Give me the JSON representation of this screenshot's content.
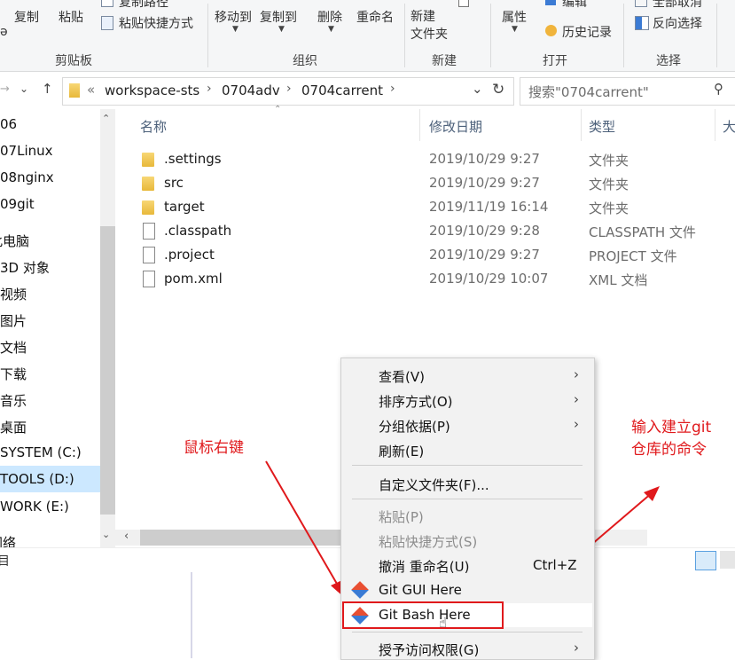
{
  "ribbon": {
    "clipboard": {
      "copy_label": "复制",
      "paste_label": "粘贴",
      "copy_path_label": "复制路径",
      "paste_shortcut_label": "粘贴快捷方式",
      "group_label": "剪贴板"
    },
    "organize": {
      "move_to_label": "移动到",
      "copy_to_label": "复制到",
      "delete_label": "删除",
      "rename_label": "重命名",
      "group_label": "组织"
    },
    "new": {
      "new_folder_label": "新建\n文件夹",
      "group_label": "新建"
    },
    "open": {
      "properties_label": "属性",
      "edit_label": "编辑",
      "history_label": "历史记录",
      "group_label": "打开"
    },
    "select": {
      "select_none_label": "全部取消",
      "invert_label": "反向选择",
      "group_label": "选择"
    }
  },
  "address": {
    "sep": "«",
    "crumbs": [
      "workspace-sts",
      "0704adv",
      "0704carrent"
    ],
    "search_placeholder": "搜索\"0704carrent\""
  },
  "nav": {
    "items": [
      "06",
      "07Linux",
      "08nginx",
      "09git",
      "此电脑",
      "3D 对象",
      "视频",
      "图片",
      "文档",
      "下载",
      "音乐",
      "桌面",
      "SYSTEM (C:)",
      "TOOLS (D:)",
      "WORK (E:)",
      "网络"
    ],
    "selected_index": 13
  },
  "columns": {
    "name": "名称",
    "date": "修改日期",
    "type": "类型",
    "size": "大"
  },
  "files": [
    {
      "name": ".settings",
      "date": "2019/10/29 9:27",
      "type": "文件夹",
      "kind": "folder"
    },
    {
      "name": "src",
      "date": "2019/10/29 9:27",
      "type": "文件夹",
      "kind": "folder"
    },
    {
      "name": "target",
      "date": "2019/11/19 16:14",
      "type": "文件夹",
      "kind": "folder"
    },
    {
      "name": ".classpath",
      "date": "2019/10/29 9:28",
      "type": "CLASSPATH 文件",
      "kind": "file"
    },
    {
      "name": ".project",
      "date": "2019/10/29 9:27",
      "type": "PROJECT 文件",
      "kind": "file"
    },
    {
      "name": "pom.xml",
      "date": "2019/10/29 10:07",
      "type": "XML 文档",
      "kind": "file"
    }
  ],
  "status": {
    "left_label": "目"
  },
  "context_menu": {
    "view": "查看(V)",
    "sort": "排序方式(O)",
    "group": "分组依据(P)",
    "refresh": "刷新(E)",
    "customize": "自定义文件夹(F)...",
    "paste": "粘贴(P)",
    "paste_shortcut": "粘贴快捷方式(S)",
    "undo_rename": "撤消 重命名(U)",
    "undo_shortcut": "Ctrl+Z",
    "git_gui": "Git GUI Here",
    "git_bash": "Git Bash Here",
    "grant_access": "授予访问权限(G)"
  },
  "annotations": {
    "right_click": "鼠标右键",
    "input_cmd": "输入建立git\n仓库的命令"
  },
  "colors": {
    "annotation": "#e0191c",
    "selection": "#cce8ff"
  }
}
